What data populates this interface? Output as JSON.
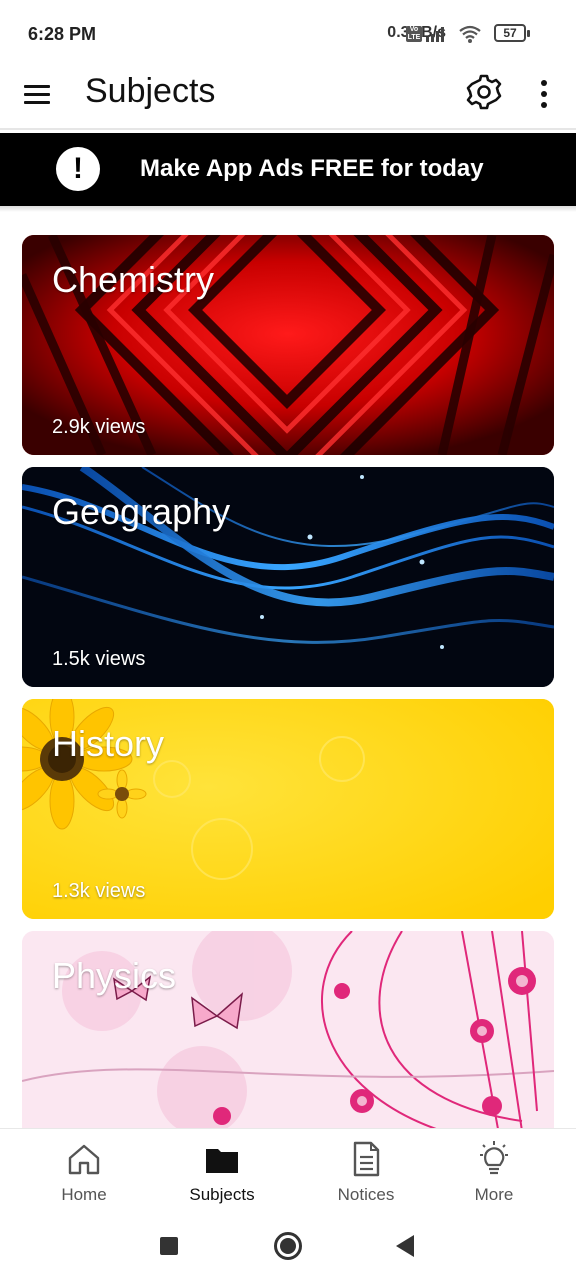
{
  "status_bar": {
    "time": "6:28 PM",
    "network_speed": "0.3KB/s",
    "volte_label": "Vo LTE",
    "battery": "57",
    "icons": [
      "volte-icon",
      "signal-icon",
      "wifi-icon",
      "battery-icon"
    ]
  },
  "app_bar": {
    "title": "Subjects",
    "icons": [
      "menu-icon",
      "gear-icon",
      "more-vert-icon"
    ]
  },
  "ad_banner": {
    "icon_glyph": "!",
    "text": "Make App Ads FREE for today"
  },
  "subjects": [
    {
      "title": "Chemistry",
      "views": "2.9k views",
      "theme": "red-geometric"
    },
    {
      "title": "Geography",
      "views": "1.5k views",
      "theme": "blue-waves"
    },
    {
      "title": "History",
      "views": "1.3k views",
      "theme": "yellow-sunflower"
    },
    {
      "title": "Physics",
      "views": "",
      "theme": "pink-floral"
    }
  ],
  "bottom_nav": {
    "items": [
      {
        "label": "Home",
        "icon": "home-icon",
        "active": false
      },
      {
        "label": "Subjects",
        "icon": "folder-icon",
        "active": true
      },
      {
        "label": "Notices",
        "icon": "document-icon",
        "active": false
      },
      {
        "label": "More",
        "icon": "lightbulb-icon",
        "active": false
      }
    ]
  },
  "colors": {
    "ad_banner_bg": "#000000",
    "chemistry_accent": "#d40000",
    "geography_accent": "#1e88ff",
    "history_accent": "#ffd400",
    "physics_accent": "#e0287a"
  }
}
